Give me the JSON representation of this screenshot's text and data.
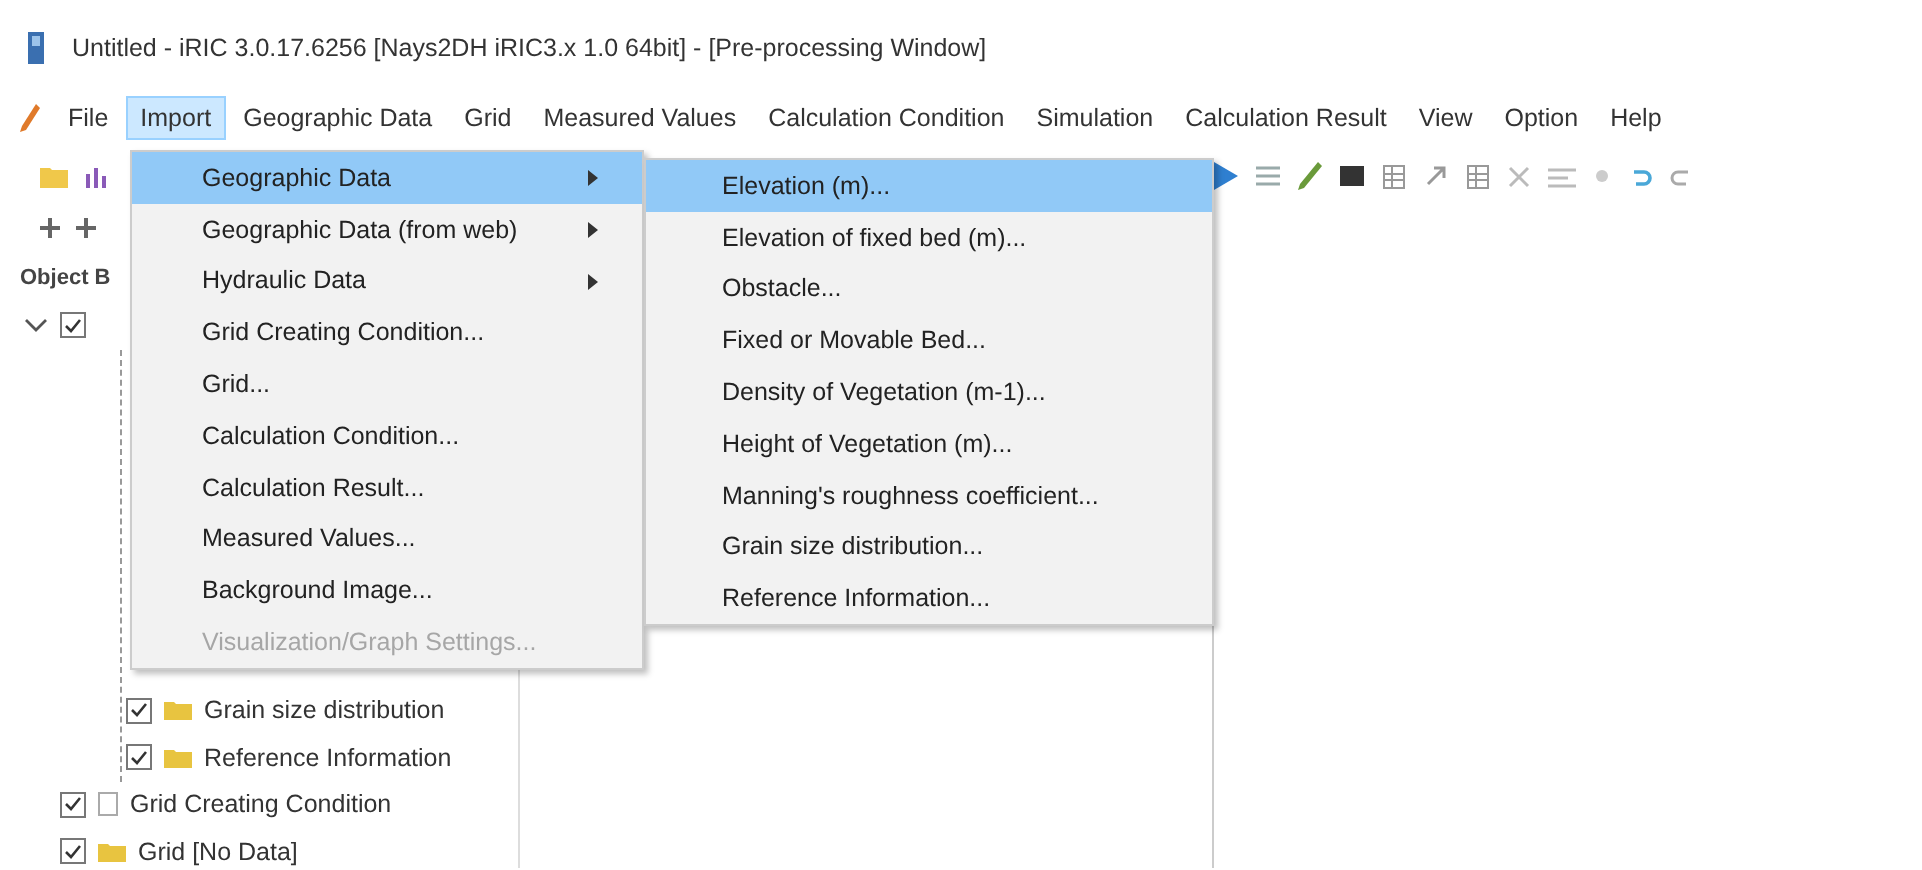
{
  "window": {
    "title": "Untitled - iRIC 3.0.17.6256 [Nays2DH iRIC3.x 1.0 64bit] - [Pre-processing Window]"
  },
  "menu_bar": [
    {
      "label": "File",
      "selected": false
    },
    {
      "label": "Import",
      "selected": true
    },
    {
      "label": "Geographic Data",
      "selected": false
    },
    {
      "label": "Grid",
      "selected": false
    },
    {
      "label": "Measured Values",
      "selected": false
    },
    {
      "label": "Calculation Condition",
      "selected": false
    },
    {
      "label": "Simulation",
      "selected": false
    },
    {
      "label": "Calculation Result",
      "selected": false
    },
    {
      "label": "View",
      "selected": false
    },
    {
      "label": "Option",
      "selected": false
    },
    {
      "label": "Help",
      "selected": false
    }
  ],
  "object_browser": {
    "title": "Object B",
    "tree": [
      {
        "checked": true,
        "expanded": true,
        "children": [
          {
            "label": "Grain size distribution",
            "checked": true,
            "kind": "folder"
          },
          {
            "label": "Reference Information",
            "checked": true,
            "kind": "folder"
          }
        ]
      },
      {
        "label": "Grid Creating Condition",
        "checked": true,
        "kind": "document"
      },
      {
        "label": "Grid [No Data]",
        "checked": true,
        "kind": "folder"
      }
    ]
  },
  "import_menu": {
    "items": [
      {
        "label": "Geographic Data",
        "kind": "submenu",
        "selected": true,
        "disabled": false
      },
      {
        "label": "Geographic Data (from web)",
        "kind": "submenu",
        "selected": false,
        "disabled": false
      },
      {
        "label": "Hydraulic Data",
        "kind": "submenu",
        "selected": false,
        "disabled": false
      },
      {
        "label": "Grid Creating Condition...",
        "kind": "action",
        "selected": false,
        "disabled": false
      },
      {
        "label": "Grid...",
        "kind": "action",
        "selected": false,
        "disabled": false
      },
      {
        "label": "Calculation Condition...",
        "kind": "action",
        "selected": false,
        "disabled": false
      },
      {
        "label": "Calculation Result...",
        "kind": "action",
        "selected": false,
        "disabled": false
      },
      {
        "label": "Measured Values...",
        "kind": "action",
        "selected": false,
        "disabled": false
      },
      {
        "label": "Background Image...",
        "kind": "action",
        "selected": false,
        "disabled": false
      },
      {
        "label": "Visualization/Graph Settings...",
        "kind": "action",
        "selected": false,
        "disabled": true
      }
    ]
  },
  "geographic_data_submenu": {
    "items": [
      {
        "label": "Elevation (m)...",
        "selected": true
      },
      {
        "label": "Elevation of fixed bed (m)...",
        "selected": false
      },
      {
        "label": "Obstacle...",
        "selected": false
      },
      {
        "label": "Fixed or Movable Bed...",
        "selected": false
      },
      {
        "label": "Density of Vegetation (m-1)...",
        "selected": false
      },
      {
        "label": "Height of Vegetation (m)...",
        "selected": false
      },
      {
        "label": "Manning's roughness coefficient...",
        "selected": false
      },
      {
        "label": "Grain size distribution...",
        "selected": false
      },
      {
        "label": "Reference Information...",
        "selected": false
      }
    ]
  }
}
